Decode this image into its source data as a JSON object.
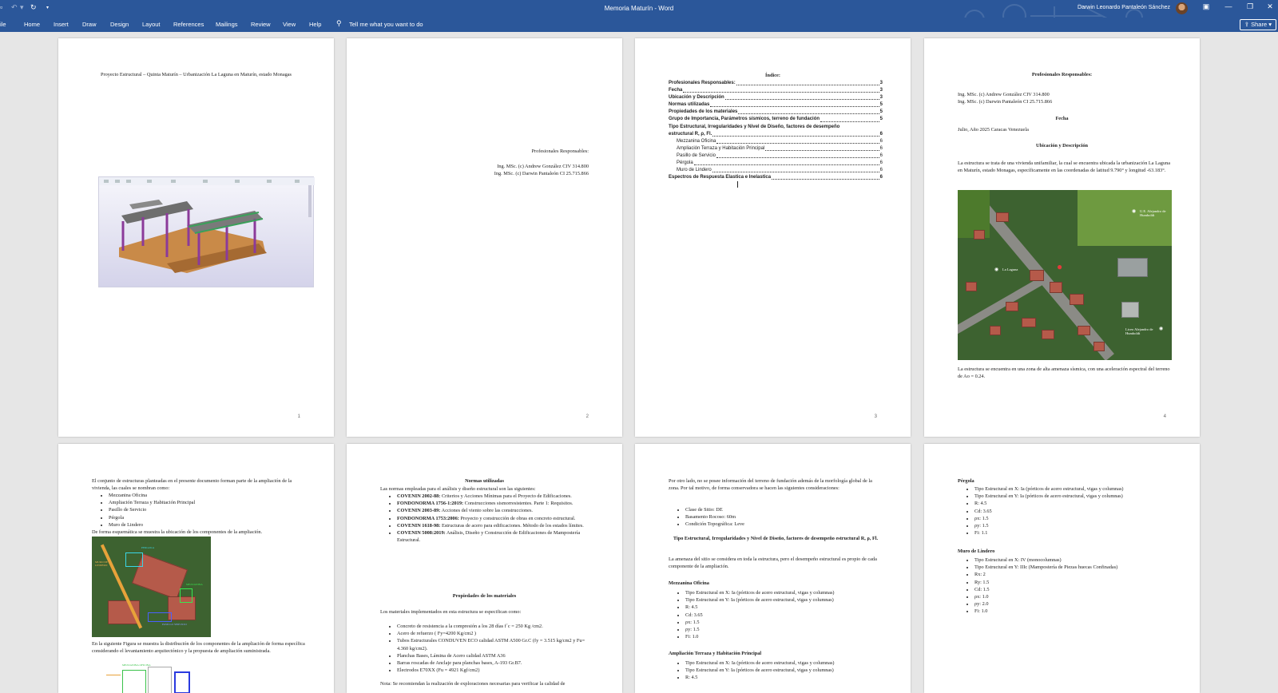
{
  "window": {
    "title": "Memoria Maturín  -  Word",
    "user": "Darwin Leonardo Pantaleón Sánchez",
    "file_tab_partial": "ile",
    "qat_more": "▾",
    "share_label": "Share",
    "search_placeholder": "Tell me what you want to do"
  },
  "ribbon_tabs": [
    "Home",
    "Insert",
    "Draw",
    "Design",
    "Layout",
    "References",
    "Mailings",
    "Review",
    "View",
    "Help"
  ],
  "pages": {
    "p1": {
      "title": "Proyecto Estructural – Quinta Maturín – Urbanización La Laguna en Maturín, estado Monagas",
      "number": "1"
    },
    "p2": {
      "heading": "Profesionales Responsables:",
      "lines": [
        "Ing. MSc. (c) Andrew González CIV 314.800",
        "Ing. MSc. (c) Darwin Pantaleón CI 25.715.866"
      ],
      "number": "2"
    },
    "p3": {
      "heading": "Índice:",
      "toc": [
        {
          "label": "Profesionales Responsables:",
          "page": "3",
          "sub": false
        },
        {
          "label": "Fecha",
          "page": "3",
          "sub": false
        },
        {
          "label": "Ubicación y Descripción",
          "page": "3",
          "sub": false
        },
        {
          "label": "Normas utilizadas",
          "page": "5",
          "sub": false
        },
        {
          "label": "Propiedades de los materiales",
          "page": "5",
          "sub": false
        },
        {
          "label": "Grupo de Importancia, Parámetros sísmicos, terreno de fundación",
          "page": "5",
          "sub": false
        },
        {
          "label": "Tipo Estructural, Irregularidades y Nivel de Diseño, factores de desempeño",
          "page": "",
          "sub": false
        },
        {
          "label": "estructural R, ρ, Fl.",
          "page": "6",
          "sub": false
        },
        {
          "label": "Mezzanina Oficina",
          "page": "6",
          "sub": true
        },
        {
          "label": "Ampliación Terraza y Habitación Principal",
          "page": "6",
          "sub": true
        },
        {
          "label": "Pasillo de Servicio",
          "page": "6",
          "sub": true
        },
        {
          "label": "Pérgola",
          "page": "6",
          "sub": true
        },
        {
          "label": "Muro de Lindero",
          "page": "6",
          "sub": true
        },
        {
          "label": "Espectros de Respuesta Elastica e Inelastica",
          "page": "6",
          "sub": false
        }
      ],
      "number": "3"
    },
    "p4": {
      "h_prof": "Profesionales Responsables:",
      "lines": [
        "Ing. MSc. (c) Andrew González CIV 314.800",
        "Ing. MSc. (c) Darwin Pantaleón CI 25.715.866"
      ],
      "h_fecha": "Fecha",
      "fecha": "Julio, Año 2025 Caracas Venezuela",
      "h_ubic": "Ubicación y Descripción",
      "ubic_text": "La estructura se trata de una vivienda unifamiliar, la cual se encuentra ubicada la urbanización La Laguna en Maturín, estado Monagas, específicamente en las coordenadas de latitud 9.790° y longitud -63.183°.",
      "map_labels": [
        "U.E. Alejandro de Humboldt",
        "La Laguna",
        "Liceo Alejandro de Humboldt"
      ],
      "after_text": "La estructura se encuentra en una zona de alta amenaza sísmica, con una aceleración espectral del terreno de Ao = 0.24.",
      "number": "4"
    },
    "p5": {
      "intro": "El conjunto de estructuras planteadas en el presente documento forman parte de la ampliación de la vivienda, las cuales se nombran como:",
      "items": [
        "Mezzanina Oficina",
        "Ampliación Terraza y Habitación Principal",
        "Pasillo de Servicio",
        "Pérgola",
        "Muro de Lindero"
      ],
      "esq": "De forma esquemática se muestra la ubicación de los componentes de la ampliación.",
      "img_labels": [
        "MURO DE LINDERO",
        "PERGOLA",
        "MEZZANINA",
        "PASILLO SERVICIO"
      ],
      "dist": "En la siguiente Figura se muestra la distribución de los componentes de la ampliación de forma específica considerando el levantamiento arquitectónico y la propuesta de ampliación suministrada.",
      "plan_label": "MEZZANINA OFICINA"
    },
    "p6": {
      "h_normas": "Normas utilizadas",
      "normas_intro": "Las normas empleadas para el análisis y diseño estructural son las siguientes:",
      "normas": [
        {
          "code": "COVENIN 2002-88:",
          "text": "Criterios y Acciones Mínimas para el Proyecto de Edificaciones."
        },
        {
          "code": "FONDONORMA 1756-1:2019:",
          "text": "Construcciones sismorresistentes. Parte 1: Requisitos."
        },
        {
          "code": "COVENIN 2003-89:",
          "text": "Acciones del viento sobre las construcciones."
        },
        {
          "code": "FONDONORMA 1753:2006:",
          "text": "Proyecto y construcción de obras en concreto estructural."
        },
        {
          "code": "COVENIN 1618-98:",
          "text": "Estructuras de acero para edificaciones. Método de los estados límites."
        },
        {
          "code": "COVENIN 5008:2019:",
          "text": "Análisis, Diseño y Construcción de Edificaciones de Mampostería Estructural."
        }
      ],
      "h_prop": "Propiedades de los materiales",
      "prop_intro": "Los materiales implementados en esta estructura se especifican como:",
      "props": [
        "Concreto de resistencia a la compresión a los 28 días f´c = 250 Kg /cm2.",
        "Acero de refuerzo ( Fy=4200 Kg/cm2 )",
        "Tubos Estructurales CONDUVEN ECO calidad ASTM A500 Gr.C (fy = 3.515 kg/cm2 y Fu= 4.360 kg/cm2).",
        "Planchas Bases, Lámina de Acero calidad ASTM A36",
        "Barras roscadas de Anclaje para planchas bases, A-193 Gr.B7.",
        "Electrodos E70XX (Fu = 4921 Kgf/cm2)"
      ],
      "nota": "Nota: Se recomiendan la realización de exploraciones necesarias para verificar la calidad de"
    },
    "p7": {
      "intro": "Por otro lado, no se posee información del terreno de fundación además de la morfología global de la zona. Por tal motivo, de forma conservadora se hacen las siguientes consideraciones:",
      "items": [
        "Clase de Sitio: DE",
        "Basamento Rocoso: 60m",
        "Condición Topográfica: Leve"
      ],
      "h_tipo": "Tipo Estructural, Irregularidades y Nivel de Diseño, factores de desempeño estructural R, ρ, Fl.",
      "tipo_text": "La amenaza del sitio se considera en toda la estructura, pero el desempeño estructural es propio de cada componente de la ampliación.",
      "h_mezz": "Mezzanina Oficina",
      "mezz": [
        "Tipo Estructural en X: Ia (pórticos de acero estructural, vigas y columnas)",
        "Tipo Estructural en Y: Ia (pórticos de acero estructural, vigas y columnas)",
        "R: 4.5",
        "Cd: 3.65",
        "ρx: 1.5",
        "ρy: 1.5",
        "Fi: 1.0"
      ],
      "h_amp": "Ampliación Terraza y Habitación Principal",
      "amp": [
        "Tipo Estructural en X: Ia (pórticos de acero estructural, vigas y columnas)",
        "Tipo Estructural en Y: Ia (pórticos de acero estructural, vigas y columnas)",
        "R: 4.5"
      ]
    },
    "p8": {
      "h_perg": "Pérgola",
      "perg": [
        "Tipo Estructural en X: Ia (pórticos de acero estructural, vigas y columnas)",
        "Tipo Estructural en Y: Ia (pórticos de acero estructural, vigas y columnas)",
        "R: 4.5",
        "Cd: 3.65",
        "ρx: 1.5",
        "ρy: 1.5",
        "Fi: 1.1"
      ],
      "h_muro": "Muro de Lindero",
      "muro": [
        "Tipo Estructural en X: IV (monocolumnas)",
        "Tipo Estructural en Y: IIIc (Mampostería de Piezas huecas Confinadas)",
        "Rx: 2",
        "Ry: 1.5",
        "Cd: 1.5",
        "ρx: 1.0",
        "ρy: 2.0",
        "Fi: 1.0"
      ]
    }
  }
}
